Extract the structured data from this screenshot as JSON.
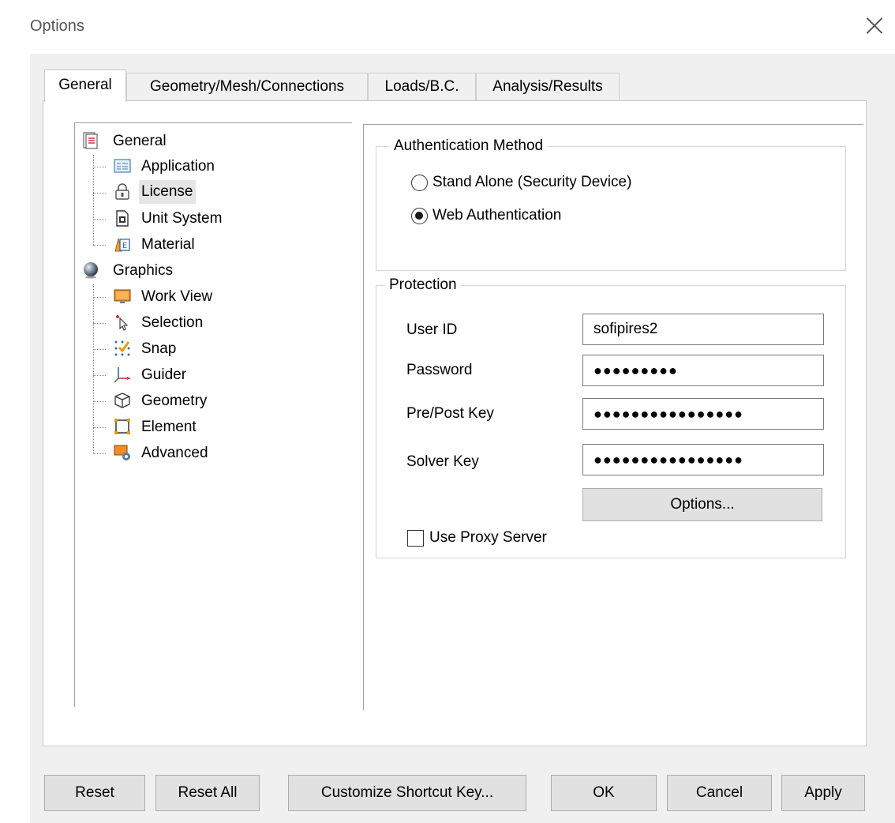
{
  "window": {
    "title": "Options"
  },
  "tabs": [
    {
      "label": "General"
    },
    {
      "label": "Geometry/Mesh/Connections"
    },
    {
      "label": "Loads/B.C."
    },
    {
      "label": "Analysis/Results"
    }
  ],
  "tree": {
    "general": "General",
    "application": "Application",
    "license": "License",
    "unit_system": "Unit System",
    "material": "Material",
    "graphics": "Graphics",
    "work_view": "Work View",
    "selection": "Selection",
    "snap": "Snap",
    "guider": "Guider",
    "geometry": "Geometry",
    "element": "Element",
    "advanced": "Advanced"
  },
  "auth": {
    "title": "Authentication Method",
    "stand_alone": "Stand Alone (Security Device)",
    "web": "Web Authentication"
  },
  "protection": {
    "title": "Protection",
    "user_id_label": "User ID",
    "user_id_value": "sofipires2",
    "password_label": "Password",
    "password_value": "●●●●●●●●●",
    "prepost_label": "Pre/Post Key",
    "prepost_value": "●●●●●●●●●●●●●●●●",
    "solver_label": "Solver Key",
    "solver_value": "●●●●●●●●●●●●●●●●",
    "options_button": "Options...",
    "proxy_label": "Use Proxy Server"
  },
  "footer": {
    "reset": "Reset",
    "reset_all": "Reset All",
    "shortcut": "Customize Shortcut Key...",
    "ok": "OK",
    "cancel": "Cancel",
    "apply": "Apply"
  }
}
